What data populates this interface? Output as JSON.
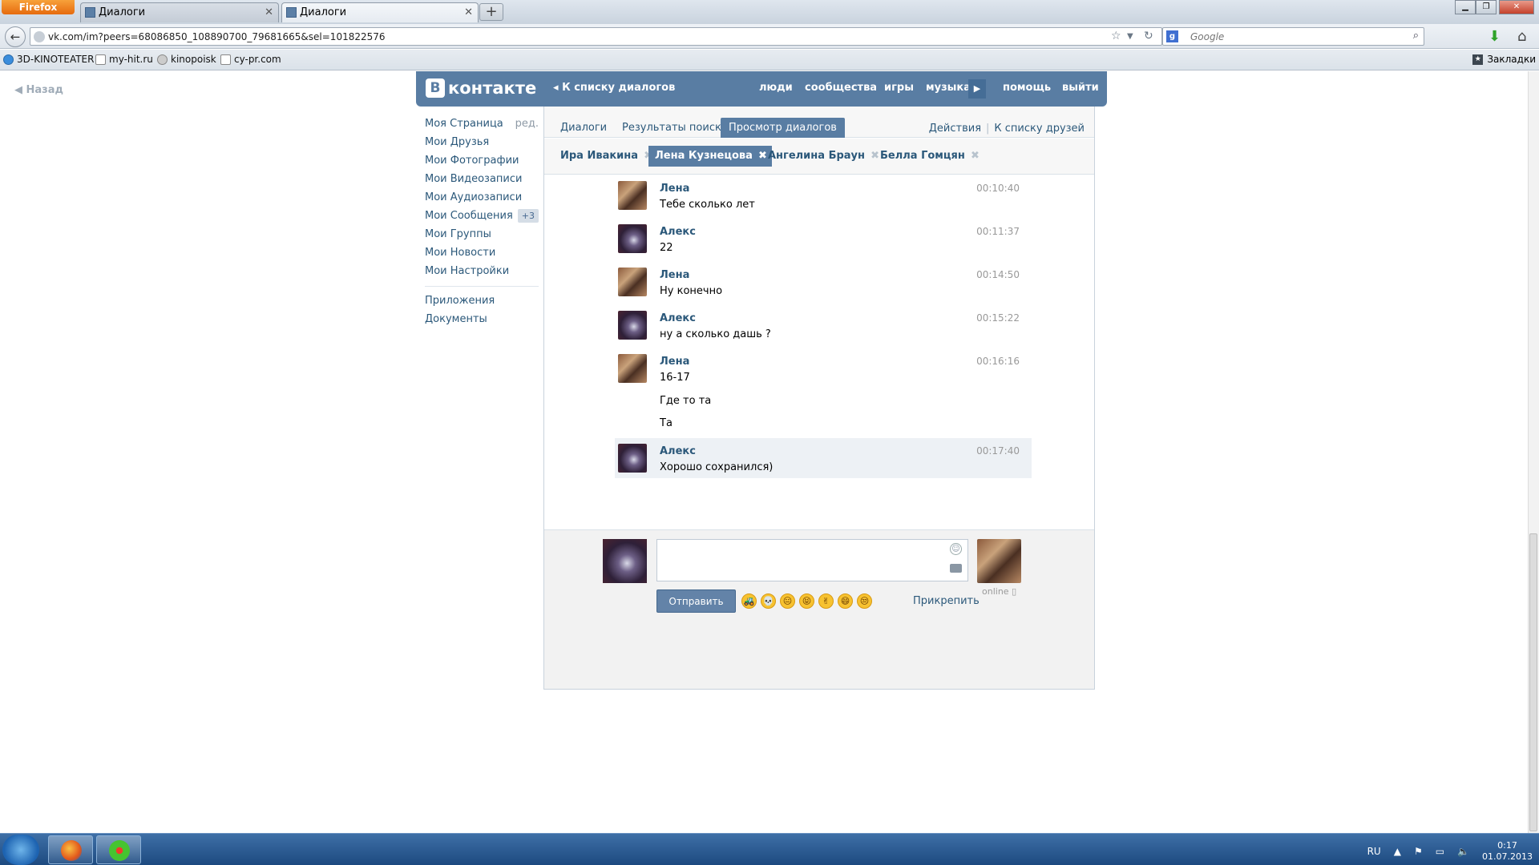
{
  "browser": {
    "app_button": "Firefox",
    "tabs": [
      {
        "label": "Диалоги"
      },
      {
        "label": "Диалоги"
      }
    ],
    "url": "vk.com/im?peers=68086850_108890700_79681665&sel=101822576",
    "search_placeholder": "Google",
    "bookmarks": [
      "3D-KINOTEATER",
      "my-hit.ru",
      "kinopoisk",
      "cy-pr.com"
    ],
    "bookmarks_menu": "Закладки"
  },
  "page": {
    "back_link": "Назад",
    "header": {
      "logo_text": "контакте",
      "logo_letter": "В",
      "to_dialogs": "К списку диалогов",
      "nav": [
        "люди",
        "сообщества",
        "игры",
        "музыка",
        "помощь",
        "выйти"
      ]
    },
    "sidebar": {
      "items": [
        {
          "label": "Моя Страница",
          "extra": "ред."
        },
        {
          "label": "Мои Друзья"
        },
        {
          "label": "Мои Фотографии"
        },
        {
          "label": "Мои Видеозаписи"
        },
        {
          "label": "Мои Аудиозаписи"
        },
        {
          "label": "Мои Сообщения",
          "badge": "+3"
        },
        {
          "label": "Мои Группы"
        },
        {
          "label": "Мои Новости"
        },
        {
          "label": "Мои Настройки"
        }
      ],
      "extra_items": [
        "Приложения",
        "Документы"
      ]
    },
    "tabs": [
      "Диалоги",
      "Результаты поиска",
      "Просмотр диалогов"
    ],
    "tabs_right": {
      "actions": "Действия",
      "friends": "К списку друзей"
    },
    "peers": [
      "Ира Ивакина",
      "Лена Кузнецова",
      "Ангелина Браун",
      "Белла Гомцян"
    ],
    "messages": [
      {
        "author": "Лена",
        "time": "00:10:40",
        "lines": [
          "Тебе сколько лет"
        ]
      },
      {
        "author": "Алекс",
        "time": "00:11:37",
        "lines": [
          "22"
        ]
      },
      {
        "author": "Лена",
        "time": "00:14:50",
        "lines": [
          "Ну конечно"
        ]
      },
      {
        "author": "Алекс",
        "time": "00:15:22",
        "lines": [
          "ну а сколько дашь ?"
        ]
      },
      {
        "author": "Лена",
        "time": "00:16:16",
        "lines": [
          "16-17",
          "Где то та",
          "Та"
        ]
      },
      {
        "author": "Алекс",
        "time": "00:17:40",
        "lines": [
          "Хорошо сохранился)"
        ]
      }
    ],
    "compose": {
      "send_label": "Отправить",
      "attach_label": "Прикрепить",
      "online_label": "online",
      "emojis": [
        "🚜",
        "💀",
        "😐",
        "😝",
        "✌",
        "😄",
        "😒"
      ]
    }
  },
  "taskbar": {
    "lang": "RU",
    "time": "0:17",
    "date": "01.07.2013"
  },
  "colors": {
    "vk_blue": "#597da3",
    "link": "#2b587a",
    "highlight": "#edf1f5"
  }
}
